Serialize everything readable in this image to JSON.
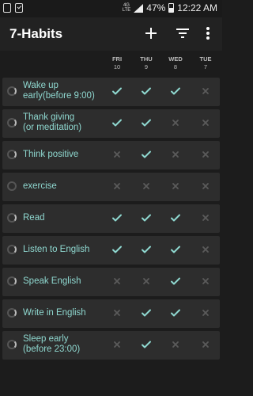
{
  "status_bar": {
    "network": "4G",
    "network_sub": "LTE",
    "battery": "47%",
    "time": "12:22 AM",
    "icons": [
      "shield-icon",
      "clipboard-check-icon",
      "signal-icon",
      "battery-icon"
    ]
  },
  "app_bar": {
    "title": "7-Habits",
    "actions": [
      "add-icon",
      "filter-icon",
      "more-vert-icon"
    ]
  },
  "days": [
    {
      "dow": "FRI",
      "date": "10"
    },
    {
      "dow": "THU",
      "date": "9"
    },
    {
      "dow": "WED",
      "date": "8"
    },
    {
      "dow": "TUE",
      "date": "7"
    }
  ],
  "colors": {
    "check": "#8fd8d0",
    "cross": "#5b5b5b",
    "habit_text": "#8fd8d0",
    "row_bg": "#2d2d2d"
  },
  "habits": [
    {
      "name": "Wake up early(before 9:00)",
      "lines": [
        "Wake up",
        "early(before 9:00)"
      ],
      "ring": "arc",
      "checks": [
        true,
        true,
        true,
        false
      ]
    },
    {
      "name": "Thank giving (or meditation)",
      "lines": [
        "Thank giving",
        "(or meditation)"
      ],
      "ring": "arc",
      "checks": [
        true,
        true,
        false,
        false
      ]
    },
    {
      "name": "Think positive",
      "lines": [
        "Think positive"
      ],
      "ring": "arc",
      "checks": [
        false,
        true,
        false,
        false
      ]
    },
    {
      "name": "exercise",
      "lines": [
        "exercise"
      ],
      "ring": "empty",
      "checks": [
        false,
        false,
        false,
        false
      ]
    },
    {
      "name": "Read",
      "lines": [
        "Read"
      ],
      "ring": "arc",
      "checks": [
        true,
        true,
        true,
        false
      ]
    },
    {
      "name": "Listen to English",
      "lines": [
        "Listen to English"
      ],
      "ring": "arc",
      "checks": [
        true,
        true,
        true,
        false
      ]
    },
    {
      "name": "Speak English",
      "lines": [
        "Speak English"
      ],
      "ring": "arc",
      "checks": [
        false,
        false,
        true,
        false
      ]
    },
    {
      "name": "Write in English",
      "lines": [
        "Write in English"
      ],
      "ring": "arc",
      "checks": [
        false,
        true,
        true,
        false
      ]
    },
    {
      "name": "Sleep early (before 23:00)",
      "lines": [
        "Sleep early",
        "(before 23:00)"
      ],
      "ring": "arc",
      "checks": [
        false,
        true,
        false,
        false
      ]
    }
  ]
}
